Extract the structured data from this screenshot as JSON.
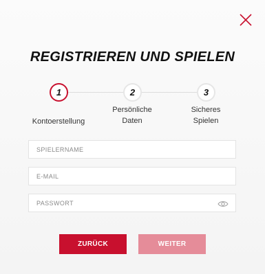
{
  "modal": {
    "title": "REGISTRIEREN UND SPIELEN"
  },
  "stepper": {
    "steps": [
      {
        "number": "1",
        "label": "Kontoerstellung",
        "active": true
      },
      {
        "number": "2",
        "label": "Persönliche Daten",
        "active": false
      },
      {
        "number": "3",
        "label": "Sicheres Spielen",
        "active": false
      }
    ]
  },
  "form": {
    "username": {
      "placeholder": "SPIELERNAME",
      "value": ""
    },
    "email": {
      "placeholder": "E-MAIL",
      "value": ""
    },
    "password": {
      "placeholder": "PASSWORT",
      "value": ""
    }
  },
  "buttons": {
    "back_label": "ZURÜCK",
    "next_label": "WEITER"
  },
  "colors": {
    "accent": "#c8102e",
    "next_button_disabled": "#e58c99"
  },
  "icons": {
    "close": "close-icon",
    "password_visibility": "eye-icon"
  }
}
